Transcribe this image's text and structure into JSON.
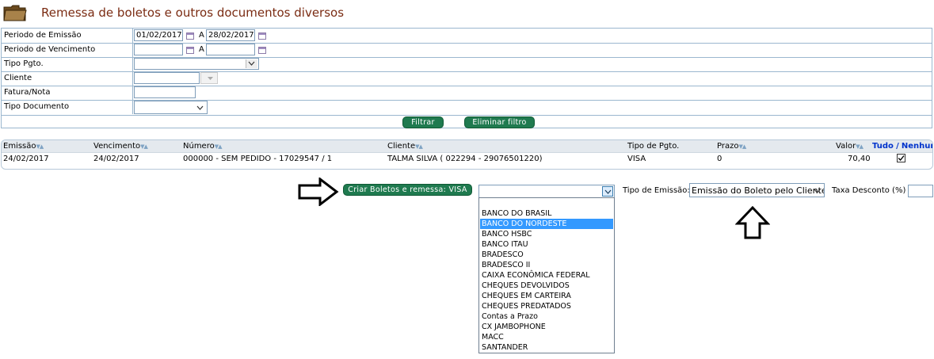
{
  "header": {
    "title": "Remessa de boletos e outros documentos diversos"
  },
  "filter": {
    "emissao_label": "Periodo de Emissão",
    "emissao_from": "01/02/2017",
    "emissao_to": "28/02/2017",
    "range_sep": "A",
    "vencimento_label": "Periodo de Vencimento",
    "vencimento_from": "",
    "vencimento_to": "",
    "tipo_pgto_label": "Tipo Pgto.",
    "tipo_pgto_value": "",
    "cliente_label": "Cliente",
    "cliente_value": "",
    "fatura_label": "Fatura/Nota",
    "fatura_value": "",
    "tipo_doc_label": "Tipo Documento",
    "tipo_doc_value": "",
    "filtrar_label": "Filtrar",
    "eliminar_label": "Eliminar filtro"
  },
  "grid": {
    "headers": {
      "emissao": "Emissão",
      "vencimento": "Vencimento",
      "numero": "Número",
      "cliente": "Cliente",
      "tipo_pgto": "Tipo de Pgto.",
      "prazo": "Prazo",
      "valor": "Valor",
      "tudo": "Tudo",
      "slash": "/",
      "nenhum": "Nenhum"
    },
    "sort_glyph": "▼▲",
    "rows": [
      {
        "emissao": "24/02/2017",
        "vencimento": "24/02/2017",
        "numero": "000000 - SEM PEDIDO - 17029547 / 1",
        "cliente": "TALMA SILVA ( 022294 - 29076501220)",
        "tipo_pgto": "VISA",
        "prazo": "0",
        "valor": "70,40",
        "checked": true
      }
    ]
  },
  "actions": {
    "criar_label": "Criar Boletos e remessa: VISA",
    "banco_select_value": "",
    "tipo_emissao_label": "Tipo de Emissão:",
    "tipo_emissao_value": "Emissão do Boleto pelo Cliente",
    "taxa_label": "Taxa Desconto (%)",
    "taxa_value": ""
  },
  "banco_options": [
    "",
    "BANCO DO BRASIL",
    "BANCO DO NORDESTE",
    "BANCO HSBC",
    "BANCO ITAU",
    "BRADESCO",
    "BRADESCO II",
    "CAIXA ECONÔMICA FEDERAL",
    "CHEQUES DEVOLVIDOS",
    "CHEQUES EM CARTEIRA",
    "CHEQUES PREDATADOS",
    "Contas a Prazo",
    "CX JAMBOPHONE",
    "MACC",
    "SANTANDER"
  ],
  "banco_selected_index": 2,
  "icons": {
    "folder": "folder-icon",
    "calendar": "calendar-icon",
    "arrow_right": "arrow-right-icon",
    "arrow_up": "arrow-up-icon"
  },
  "colors": {
    "title": "#7a2b12",
    "button": "#1f7a4f",
    "link": "#0033cc",
    "selected_option": "#3399ff"
  }
}
